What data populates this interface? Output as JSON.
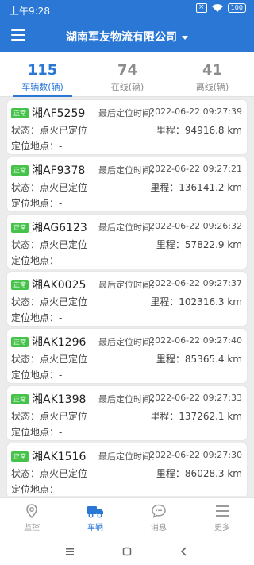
{
  "status_bar": {
    "time": "上午9:28",
    "battery": "100"
  },
  "app_bar": {
    "title": "湖南军友物流有限公司"
  },
  "tabs": [
    {
      "count": "115",
      "label": "车辆数(辆)",
      "active": true
    },
    {
      "count": "74",
      "label": "在线(辆)",
      "active": false
    },
    {
      "count": "41",
      "label": "离线(辆)",
      "active": false
    }
  ],
  "vehicles": [
    {
      "badge": "正常",
      "plate": "湘AF5259",
      "time_label": "最后定位时间：",
      "time": "2022-06-22 09:27:39",
      "status": "状态：点火已定位",
      "mileage": "里程：94916.8 km",
      "location": "定位地点：-"
    },
    {
      "badge": "正常",
      "plate": "湘AF9378",
      "time_label": "最后定位时间：",
      "time": "2022-06-22 09:27:21",
      "status": "状态：点火已定位",
      "mileage": "里程：136141.2 km",
      "location": "定位地点：-"
    },
    {
      "badge": "正常",
      "plate": "湘AG6123",
      "time_label": "最后定位时间：",
      "time": "2022-06-22 09:26:32",
      "status": "状态：点火已定位",
      "mileage": "里程：57822.9 km",
      "location": "定位地点：-"
    },
    {
      "badge": "正常",
      "plate": "湘AK0025",
      "time_label": "最后定位时间：",
      "time": "2022-06-22 09:27:37",
      "status": "状态：点火已定位",
      "mileage": "里程：102316.3 km",
      "location": "定位地点：-"
    },
    {
      "badge": "正常",
      "plate": "湘AK1296",
      "time_label": "最后定位时间：",
      "time": "2022-06-22 09:27:40",
      "status": "状态：点火已定位",
      "mileage": "里程：85365.4 km",
      "location": "定位地点：-"
    },
    {
      "badge": "正常",
      "plate": "湘AK1398",
      "time_label": "最后定位时间：",
      "time": "2022-06-22 09:27:33",
      "status": "状态：点火已定位",
      "mileage": "里程：137262.1 km",
      "location": "定位地点：-"
    },
    {
      "badge": "正常",
      "plate": "湘AK1516",
      "time_label": "最后定位时间：",
      "time": "2022-06-22 09:27:30",
      "status": "状态：点火已定位",
      "mileage": "里程：86028.3 km",
      "location": "定位地点：-"
    }
  ],
  "bottom_nav": [
    {
      "label": "监控",
      "icon": "location-pin-icon",
      "active": false
    },
    {
      "label": "车辆",
      "icon": "truck-icon",
      "active": true
    },
    {
      "label": "消息",
      "icon": "chat-bubble-icon",
      "active": false
    },
    {
      "label": "更多",
      "icon": "more-lines-icon",
      "active": false
    }
  ],
  "colors": {
    "primary": "#2a77d6",
    "badge_green": "#45c24a"
  }
}
